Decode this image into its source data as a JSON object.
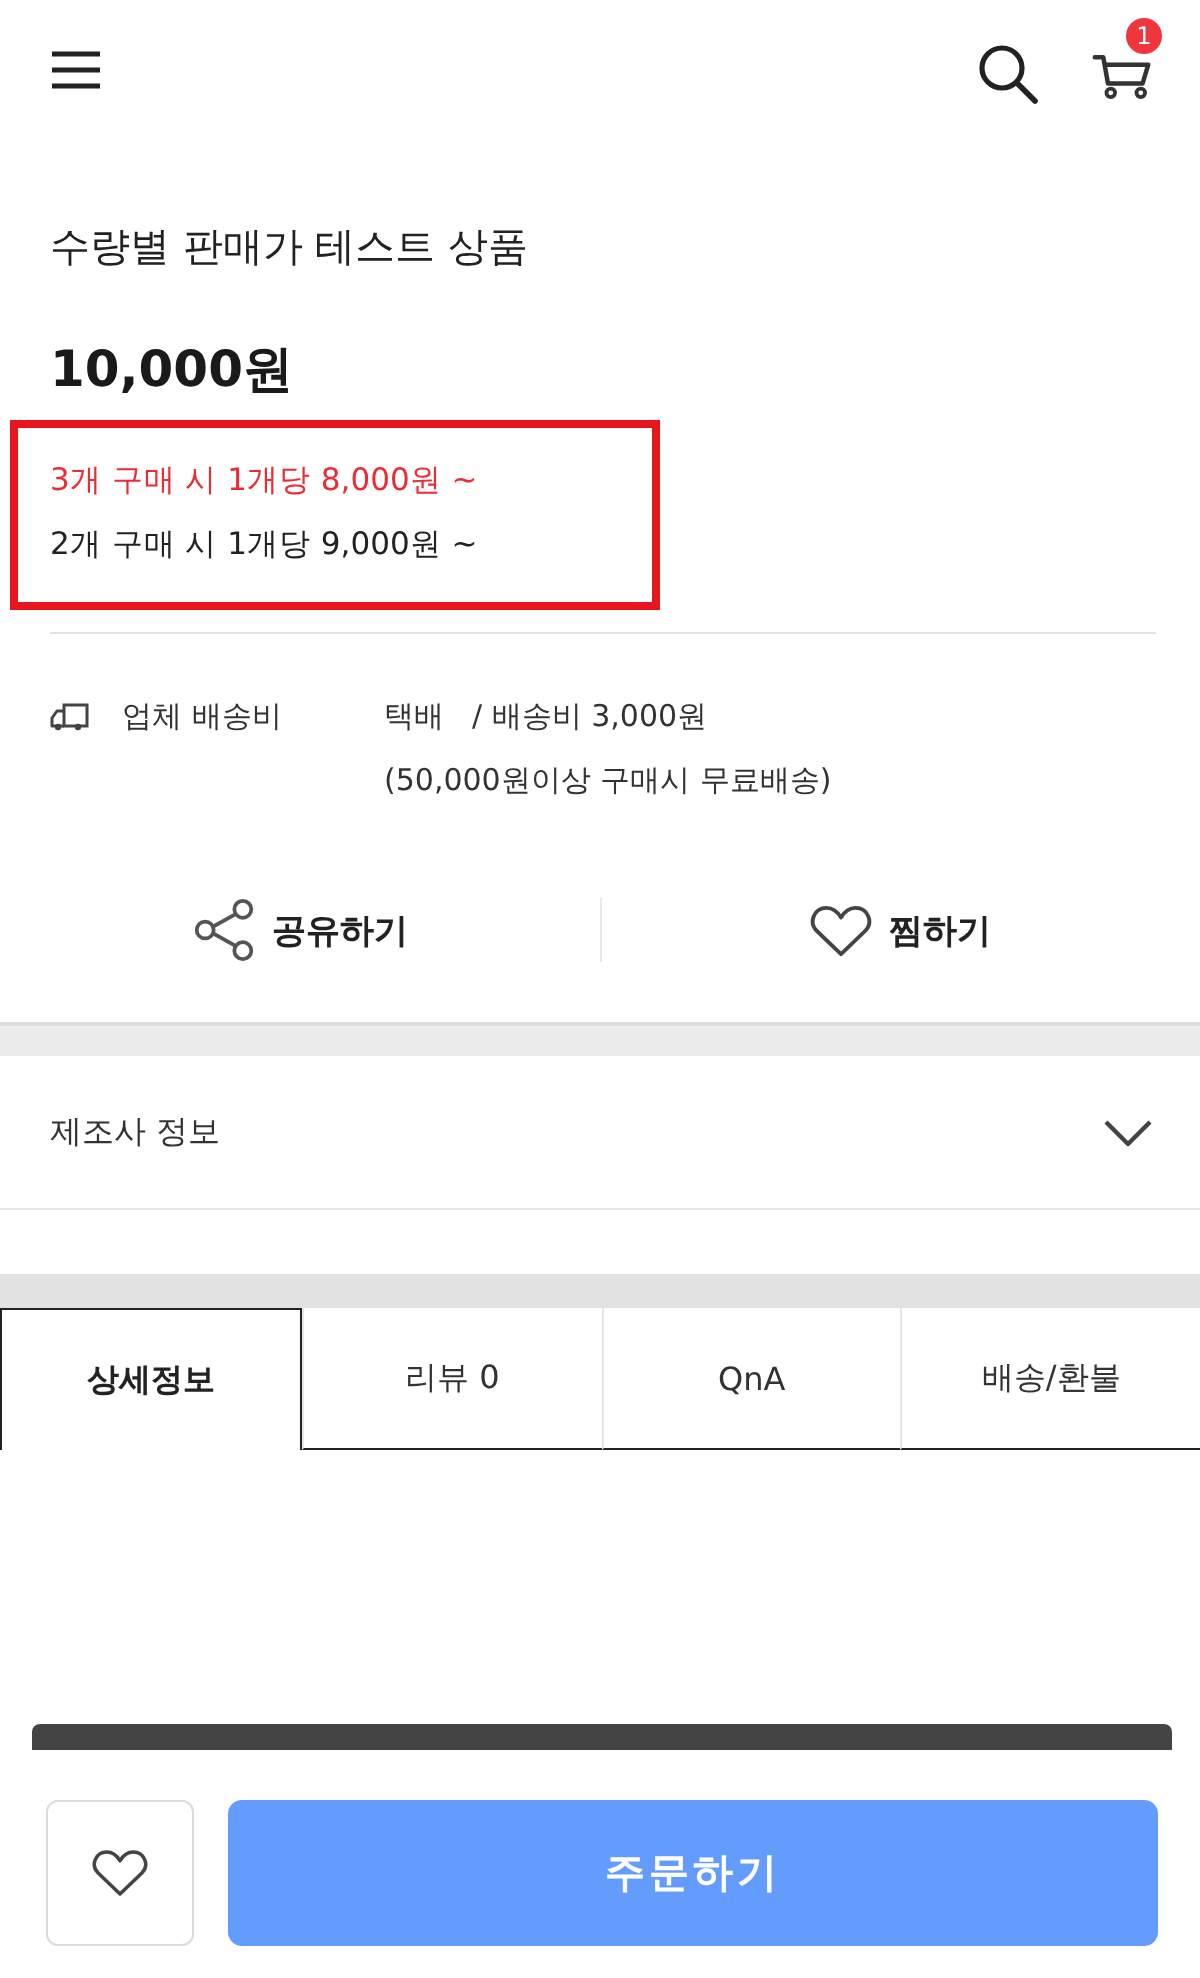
{
  "header": {
    "cart_count": "1"
  },
  "product": {
    "title": "수량별 판매가 테스트 상품",
    "price": "10,000원",
    "tier_prices": [
      {
        "text": "3개 구매 시 1개당 8,000원 ~",
        "highlighted": true
      },
      {
        "text": "2개 구매 시 1개당 9,000원 ~",
        "highlighted": false
      }
    ]
  },
  "shipping": {
    "label": "업체 배송비",
    "method": "택배",
    "fee": "/ 배송비 3,000원",
    "note": "(50,000원이상 구매시 무료배송)"
  },
  "actions": [
    {
      "label": "공유하기",
      "kind": "share"
    },
    {
      "label": "찜하기",
      "kind": "wishlist"
    }
  ],
  "manufacturer_info": {
    "label": "제조사 정보",
    "expanded": false
  },
  "tabs": [
    {
      "label": "상세정보",
      "selected": true
    },
    {
      "label": "리뷰 0",
      "selected": false
    },
    {
      "label": "QnA",
      "selected": false
    },
    {
      "label": "배송/환불",
      "selected": false
    }
  ],
  "bottom_bar": {
    "order_button": "주문하기"
  }
}
